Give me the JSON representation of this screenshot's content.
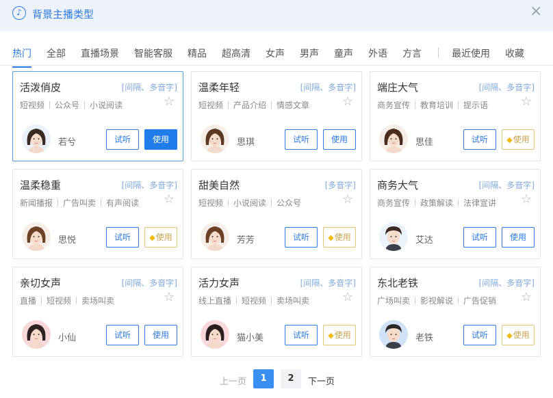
{
  "header": {
    "title": "背景主播类型",
    "close_label": "×"
  },
  "tabs": [
    "热门",
    "全部",
    "直播场景",
    "智能客服",
    "精品",
    "超高清",
    "女声",
    "男声",
    "童声",
    "外语",
    "方言",
    "最近使用",
    "收藏"
  ],
  "cards": [
    {
      "name": "活泼俏皮",
      "badge": "[间隔、多音字]",
      "tags": [
        "短视频",
        "公众号",
        "小说阅读"
      ],
      "speaker": "若兮",
      "listen": "试听",
      "use": "使用",
      "use_style": "primary",
      "avatar": "female-avatar",
      "hair": "#3a2b22",
      "bg": "#eaf2fb"
    },
    {
      "name": "温柔年轻",
      "badge": "[间隔、多音字]",
      "tags": [
        "短视频",
        "产品介绍",
        "情感文章"
      ],
      "speaker": "思琪",
      "listen": "试听",
      "use": "使用",
      "use_style": "normal",
      "avatar": "female-avatar",
      "hair": "#5a3a24",
      "bg": "#f7efe7"
    },
    {
      "name": "端庄大气",
      "badge": "[间隔、多音字]",
      "tags": [
        "商务宣传",
        "教育培训",
        "提示语"
      ],
      "speaker": "思佳",
      "listen": "试听",
      "use": "使用",
      "use_style": "vip",
      "avatar": "female-avatar",
      "hair": "#4a2d1f",
      "bg": "#f6eee6"
    },
    {
      "name": "温柔稳重",
      "badge": "[间隔、多音字]",
      "tags": [
        "新闻播报",
        "广告叫卖",
        "有声阅读"
      ],
      "speaker": "思悦",
      "listen": "试听",
      "use": "使用",
      "use_style": "vip",
      "avatar": "female-avatar",
      "hair": "#6b4428",
      "bg": "#f6eee6"
    },
    {
      "name": "甜美自然",
      "badge": "[多音字]",
      "tags": [
        "短视频",
        "小说阅读",
        "公众号"
      ],
      "speaker": "芳芳",
      "listen": "试听",
      "use": "使用",
      "use_style": "vip",
      "avatar": "female-avatar",
      "hair": "#6a4126",
      "bg": "#f7efe7"
    },
    {
      "name": "商务大气",
      "badge": "[间隔、多音字]",
      "tags": [
        "商务宣传",
        "政策解读",
        "法律宣讲"
      ],
      "speaker": "艾达",
      "listen": "试听",
      "use": "使用",
      "use_style": "normal",
      "avatar": "male-avatar",
      "hair": "#3b2a20",
      "bg": "#eaf2fb"
    },
    {
      "name": "亲切女声",
      "badge": "[间隔、多音字]",
      "tags": [
        "直播",
        "短视频",
        "卖场叫卖"
      ],
      "speaker": "小仙",
      "listen": "试听",
      "use": "使用",
      "use_style": "normal",
      "avatar": "female-avatar",
      "hair": "#2d2220",
      "bg": "#f8d8d8"
    },
    {
      "name": "活力女声",
      "badge": "[间隔、多音字]",
      "tags": [
        "线上直播",
        "短视频",
        "卖场叫卖"
      ],
      "speaker": "猫小美",
      "listen": "试听",
      "use": "使用",
      "use_style": "vip",
      "avatar": "female-avatar",
      "hair": "#2a1f1e",
      "bg": "#f8d8d8"
    },
    {
      "name": "东北老铁",
      "badge": "[间隔、多音字]",
      "tags": [
        "广场叫卖",
        "影视解说",
        "广告促销"
      ],
      "speaker": "老铁",
      "listen": "试听",
      "use": "使用",
      "use_style": "vip",
      "avatar": "male-avatar",
      "hair": "#2a2a2a",
      "bg": "#cfe2f7"
    }
  ],
  "pagination": {
    "prev": "上一页",
    "pages": [
      "1",
      "2"
    ],
    "next": "下一页",
    "current": 1
  },
  "colors": {
    "accent": "#2d7be5",
    "vip": "#e5c57a"
  },
  "icons": {
    "header": "music-note-icon",
    "close": "close-icon",
    "favorite": "star-outline-icon",
    "vip": "diamond-icon"
  }
}
